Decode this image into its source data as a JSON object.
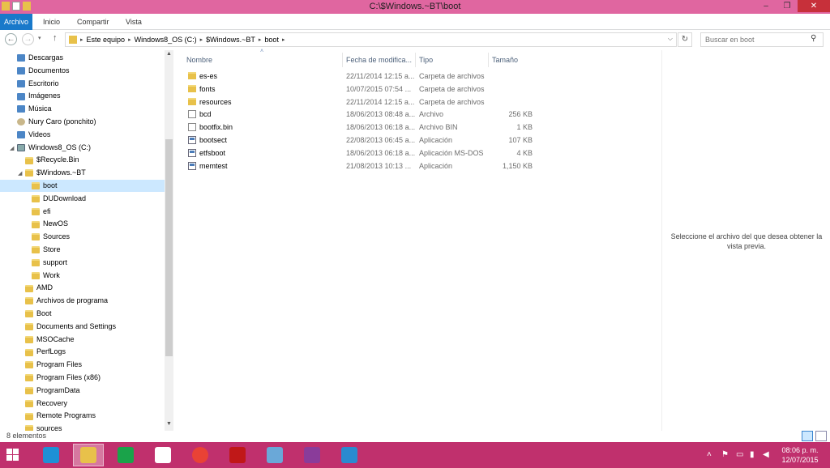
{
  "window": {
    "title": "C:\\$Windows.~BT\\boot",
    "minimize": "–",
    "maximize": "❐",
    "close": "✕"
  },
  "ribbon": {
    "tabs": [
      "Archivo",
      "Inicio",
      "Compartir",
      "Vista"
    ]
  },
  "address": {
    "crumbs": [
      "Este equipo",
      "Windows8_OS (C:)",
      "$Windows.~BT",
      "boot"
    ],
    "search_placeholder": "Buscar en boot"
  },
  "nav_tree": [
    {
      "label": "Descargas",
      "icon": "download-folder-icon",
      "kind": "special",
      "indent": 0
    },
    {
      "label": "Documentos",
      "icon": "documents-folder-icon",
      "kind": "special",
      "indent": 0
    },
    {
      "label": "Escritorio",
      "icon": "desktop-folder-icon",
      "kind": "special",
      "indent": 0
    },
    {
      "label": "Imágenes",
      "icon": "pictures-folder-icon",
      "kind": "special",
      "indent": 0
    },
    {
      "label": "Música",
      "icon": "music-folder-icon",
      "kind": "special",
      "indent": 0
    },
    {
      "label": "Nury Caro (ponchito)",
      "icon": "user-icon",
      "kind": "user",
      "indent": 0
    },
    {
      "label": "Videos",
      "icon": "videos-folder-icon",
      "kind": "special",
      "indent": 0
    },
    {
      "label": "Windows8_OS (C:)",
      "icon": "drive-icon",
      "kind": "drive",
      "indent": 0,
      "expanded": true
    },
    {
      "label": "$Recycle.Bin",
      "icon": "folder-icon",
      "kind": "folder",
      "indent": 1
    },
    {
      "label": "$Windows.~BT",
      "icon": "folder-icon",
      "kind": "folder",
      "indent": 1,
      "expanded": true
    },
    {
      "label": "boot",
      "icon": "folder-icon",
      "kind": "folder",
      "indent": 2,
      "selected": true
    },
    {
      "label": "DUDownload",
      "icon": "folder-icon",
      "kind": "folder",
      "indent": 2
    },
    {
      "label": "efi",
      "icon": "folder-icon",
      "kind": "folder",
      "indent": 2
    },
    {
      "label": "NewOS",
      "icon": "folder-icon",
      "kind": "folder",
      "indent": 2
    },
    {
      "label": "Sources",
      "icon": "folder-icon",
      "kind": "folder",
      "indent": 2
    },
    {
      "label": "Store",
      "icon": "folder-icon",
      "kind": "folder",
      "indent": 2
    },
    {
      "label": "support",
      "icon": "folder-icon",
      "kind": "folder",
      "indent": 2
    },
    {
      "label": "Work",
      "icon": "folder-icon",
      "kind": "folder",
      "indent": 2
    },
    {
      "label": "AMD",
      "icon": "folder-icon",
      "kind": "folder",
      "indent": 1
    },
    {
      "label": "Archivos de programa",
      "icon": "shortcut-folder-icon",
      "kind": "folder",
      "indent": 1
    },
    {
      "label": "Boot",
      "icon": "folder-icon",
      "kind": "folder",
      "indent": 1
    },
    {
      "label": "Documents and Settings",
      "icon": "shortcut-folder-icon",
      "kind": "folder",
      "indent": 1
    },
    {
      "label": "MSOCache",
      "icon": "folder-icon",
      "kind": "folder",
      "indent": 1
    },
    {
      "label": "PerfLogs",
      "icon": "folder-icon",
      "kind": "folder",
      "indent": 1
    },
    {
      "label": "Program Files",
      "icon": "folder-icon",
      "kind": "folder",
      "indent": 1
    },
    {
      "label": "Program Files (x86)",
      "icon": "folder-icon",
      "kind": "folder",
      "indent": 1
    },
    {
      "label": "ProgramData",
      "icon": "folder-icon",
      "kind": "folder",
      "indent": 1
    },
    {
      "label": "Recovery",
      "icon": "folder-icon",
      "kind": "folder",
      "indent": 1
    },
    {
      "label": "Remote Programs",
      "icon": "folder-icon",
      "kind": "folder",
      "indent": 1
    },
    {
      "label": "sources",
      "icon": "folder-icon",
      "kind": "folder",
      "indent": 1
    }
  ],
  "columns": {
    "name": "Nombre",
    "date": "Fecha de modifica...",
    "type": "Tipo",
    "size": "Tamaño"
  },
  "files": [
    {
      "name": "es-es",
      "date": "22/11/2014 12:15 a...",
      "type": "Carpeta de archivos",
      "size": "",
      "icon": "folder"
    },
    {
      "name": "fonts",
      "date": "10/07/2015 07:54 ...",
      "type": "Carpeta de archivos",
      "size": "",
      "icon": "folder"
    },
    {
      "name": "resources",
      "date": "22/11/2014 12:15 a...",
      "type": "Carpeta de archivos",
      "size": "",
      "icon": "folder"
    },
    {
      "name": "bcd",
      "date": "18/06/2013 08:48 a...",
      "type": "Archivo",
      "size": "256 KB",
      "icon": "file"
    },
    {
      "name": "bootfix.bin",
      "date": "18/06/2013 06:18 a...",
      "type": "Archivo BIN",
      "size": "1 KB",
      "icon": "file"
    },
    {
      "name": "bootsect",
      "date": "22/08/2013 06:45 a...",
      "type": "Aplicación",
      "size": "107 KB",
      "icon": "app"
    },
    {
      "name": "etfsboot",
      "date": "18/06/2013 06:18 a...",
      "type": "Aplicación MS-DOS",
      "size": "4 KB",
      "icon": "app"
    },
    {
      "name": "memtest",
      "date": "21/08/2013 10:13 ...",
      "type": "Aplicación",
      "size": "1,150 KB",
      "icon": "app"
    }
  ],
  "preview": {
    "message": "Seleccione el archivo del que desea obtener la vista previa."
  },
  "status": {
    "count": "8 elementos"
  },
  "taskbar": {
    "apps": [
      {
        "name": "internet-explorer-icon",
        "color": "#1e90d6",
        "active": false
      },
      {
        "name": "file-explorer-icon",
        "color": "#e8c14a",
        "active": true
      },
      {
        "name": "store-icon",
        "color": "#1aa34a",
        "active": false
      },
      {
        "name": "amazon-icon",
        "color": "#ffffff",
        "active": false
      },
      {
        "name": "chrome-icon",
        "color": "#e94235",
        "active": false
      },
      {
        "name": "mcafee-icon",
        "color": "#c01818",
        "active": false
      },
      {
        "name": "media-tool-icon",
        "color": "#6aa8d8",
        "active": false
      },
      {
        "name": "winrar-icon",
        "color": "#8a3c9a",
        "active": false
      },
      {
        "name": "photos-icon",
        "color": "#2a8ad0",
        "active": false
      }
    ],
    "time": "08:06 p. m.",
    "date": "12/07/2015"
  },
  "colors": {
    "titlebar": "#e066a0",
    "taskbar": "#c0306d",
    "file_tab": "#1979ca",
    "selection": "#cce8ff"
  }
}
